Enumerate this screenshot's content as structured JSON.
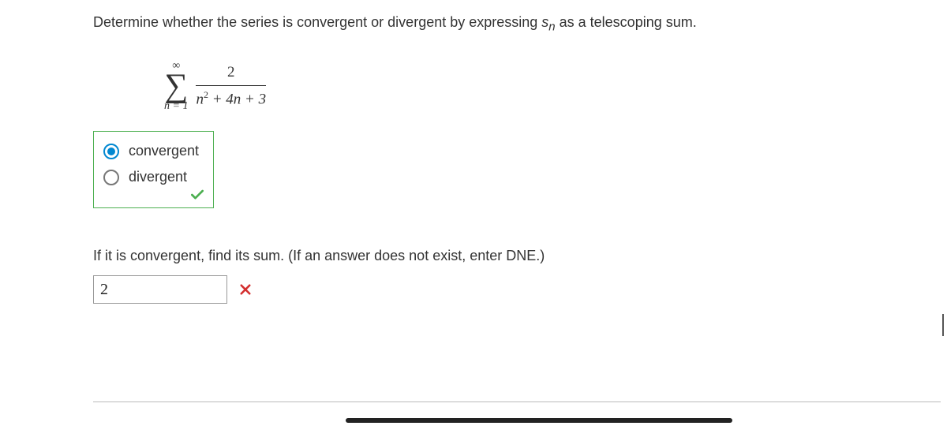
{
  "question": {
    "prefix": "Determine whether the series is convergent or divergent by expressing ",
    "var": "s",
    "sub": "n",
    "suffix": " as a telescoping sum."
  },
  "formula": {
    "upper": "∞",
    "lower": "n = 1",
    "numerator": "2",
    "denom_n": "n",
    "denom_sup": "2",
    "denom_rest": " + 4n + 3"
  },
  "options": {
    "opt1": "convergent",
    "opt2": "divergent",
    "selected": "opt1",
    "correct": true
  },
  "part2": {
    "prompt": "If it is convergent, find its sum. (If an answer does not exist, enter DNE.)",
    "value": "2",
    "correct": false
  },
  "icons": {
    "check_color": "#4caf50",
    "x_color": "#d32f2f",
    "radio_selected_color": "#0288d1"
  }
}
